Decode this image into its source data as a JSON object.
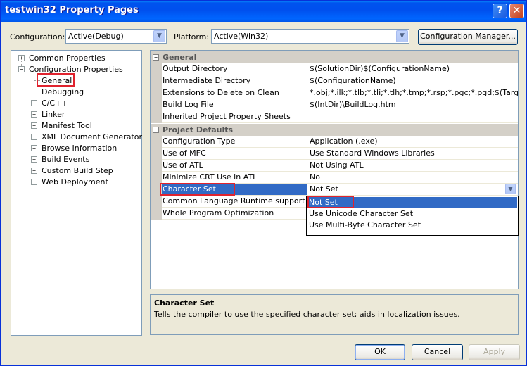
{
  "window": {
    "title": "testwin32 Property Pages",
    "help": "?",
    "close": "✕"
  },
  "top": {
    "configuration_label": "Configuration:",
    "configuration_value": "Active(Debug)",
    "platform_label": "Platform:",
    "platform_value": "Active(Win32)",
    "config_manager_button": "Configuration Manager..."
  },
  "tree": {
    "common_properties": "Common Properties",
    "configuration_properties": "Configuration Properties",
    "children": [
      "General",
      "Debugging",
      "C/C++",
      "Linker",
      "Manifest Tool",
      "XML Document Generator",
      "Browse Information",
      "Build Events",
      "Custom Build Step",
      "Web Deployment"
    ]
  },
  "grid": {
    "categories": [
      "General",
      "Project Defaults"
    ],
    "general_rows": [
      {
        "name": "Output Directory",
        "value": "$(SolutionDir)$(ConfigurationName)"
      },
      {
        "name": "Intermediate Directory",
        "value": "$(ConfigurationName)"
      },
      {
        "name": "Extensions to Delete on Clean",
        "value": "*.obj;*.ilk;*.tlb;*.tli;*.tlh;*.tmp;*.rsp;*.pgc;*.pgd;$(TargetPath)"
      },
      {
        "name": "Build Log File",
        "value": "$(IntDir)\\BuildLog.htm"
      },
      {
        "name": "Inherited Project Property Sheets",
        "value": ""
      }
    ],
    "defaults_rows": [
      {
        "name": "Configuration Type",
        "value": "Application (.exe)"
      },
      {
        "name": "Use of MFC",
        "value": "Use Standard Windows Libraries"
      },
      {
        "name": "Use of ATL",
        "value": "Not Using ATL"
      },
      {
        "name": "Minimize CRT Use in ATL",
        "value": "No"
      },
      {
        "name": "Character Set",
        "value": "Not Set"
      },
      {
        "name": "Common Language Runtime support",
        "value": ""
      },
      {
        "name": "Whole Program Optimization",
        "value": ""
      }
    ],
    "dropdown_options": [
      "Not Set",
      "Use Unicode Character Set",
      "Use Multi-Byte Character Set"
    ]
  },
  "description": {
    "title": "Character Set",
    "text": "Tells the compiler to use the specified character set; aids in localization issues."
  },
  "buttons": {
    "ok": "OK",
    "cancel": "Cancel",
    "apply": "Apply"
  }
}
